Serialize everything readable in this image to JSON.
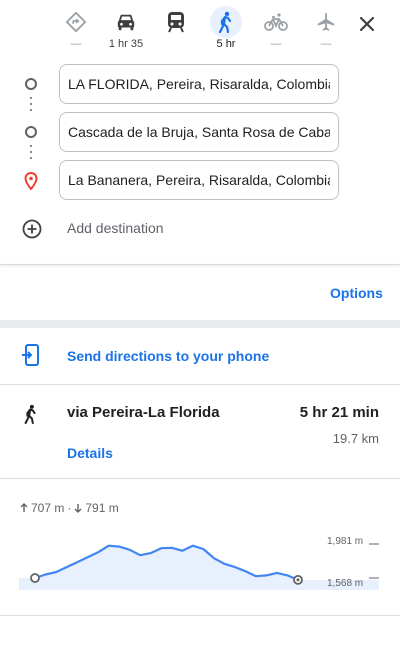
{
  "travel_modes": [
    {
      "name": "best",
      "icon": "directions-icon",
      "sub": "—"
    },
    {
      "name": "driving",
      "icon": "car-icon",
      "sub": "1 hr 35"
    },
    {
      "name": "transit",
      "icon": "transit-icon",
      "sub": ""
    },
    {
      "name": "walking",
      "icon": "walk-icon",
      "sub": "5 hr",
      "active": true
    },
    {
      "name": "cycling",
      "icon": "bicycle-icon",
      "sub": "—"
    },
    {
      "name": "flights",
      "icon": "airplane-icon",
      "sub": "—"
    }
  ],
  "waypoints": [
    {
      "value": "LA FLORIDA, Pereira, Risaralda, Colombia"
    },
    {
      "value": "Cascada de la Bruja, Santa Rosa de Cabal, Risaralda, Colombia"
    },
    {
      "value": "La Bananera, Pereira, Risaralda, Colombia"
    }
  ],
  "add_destination": "Add destination",
  "options_label": "Options",
  "send_label": "Send directions to your phone",
  "route": {
    "via": "via Pereira-La Florida",
    "time": "5 hr 21 min",
    "distance": "19.7 km",
    "details": "Details"
  },
  "elevation": {
    "ascent": "707 m",
    "separator": "·",
    "descent": "791 m",
    "max_label": "1,981 m",
    "min_label": "1,568 m",
    "profile": [
      1568,
      1610,
      1640,
      1700,
      1760,
      1820,
      1880,
      1960,
      1950,
      1910,
      1845,
      1870,
      1930,
      1935,
      1900,
      1960,
      1920,
      1810,
      1740,
      1700,
      1650,
      1590,
      1600,
      1630,
      1600,
      1545
    ]
  },
  "colors": {
    "accent": "#1a73e8",
    "active_mode_bg": "#e8f0fe",
    "pin_red": "#ea4335",
    "profile_line": "#4285f4",
    "profile_fill": "#e8f0fe"
  }
}
